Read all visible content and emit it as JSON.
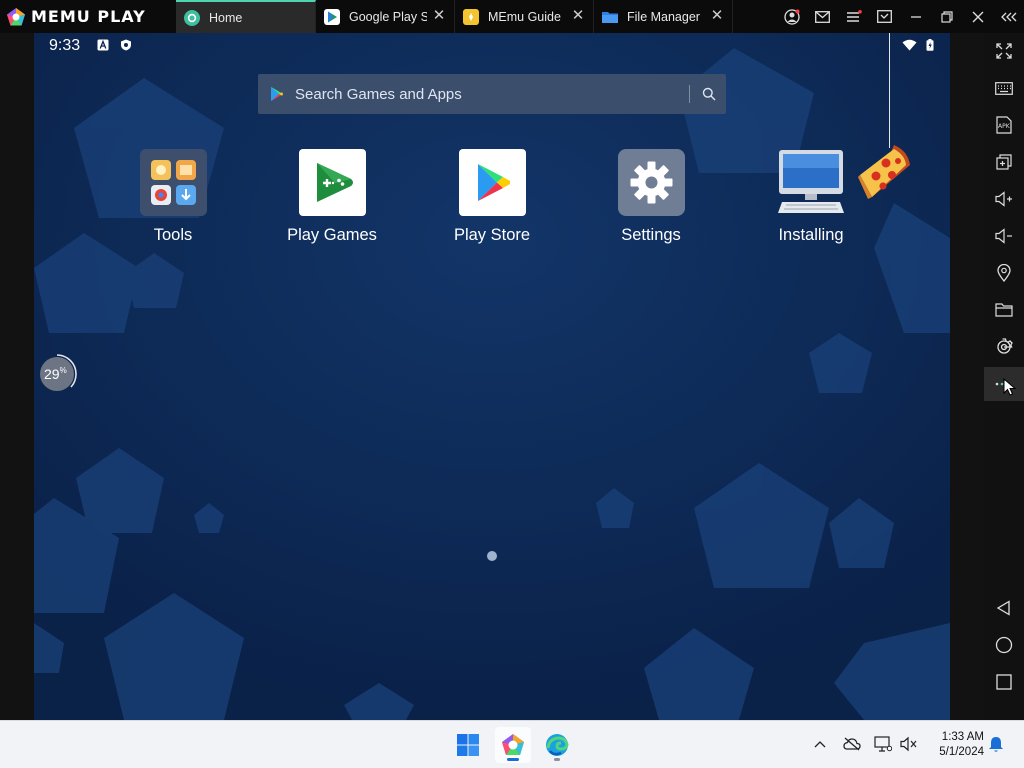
{
  "brand": {
    "name": "MEMU PLAY"
  },
  "tabs": [
    {
      "label": "Home",
      "icon": "memu-home-icon",
      "active": true
    },
    {
      "label": "Google Play S",
      "icon": "google-play-icon",
      "active": false
    },
    {
      "label": "MEmu Guide",
      "icon": "guide-icon",
      "active": false
    },
    {
      "label": "File Manager",
      "icon": "folder-icon",
      "active": false
    }
  ],
  "window_controls": [
    "account-icon",
    "mail-icon",
    "menu-icon",
    "multi-window-icon",
    "minimize-icon",
    "restore-icon",
    "close-icon",
    "collapse-sidebar-icon"
  ],
  "statusbar": {
    "time": "9:33"
  },
  "search": {
    "placeholder": "Search Games and Apps"
  },
  "apps": [
    {
      "label": "Tools",
      "icon": "tools-folder-icon"
    },
    {
      "label": "Play Games",
      "icon": "play-games-icon"
    },
    {
      "label": "Play Store",
      "icon": "play-store-icon"
    },
    {
      "label": "Settings",
      "icon": "settings-gear-icon"
    },
    {
      "label": "Installing",
      "icon": "computer-install-icon"
    }
  ],
  "progress": {
    "value": "29",
    "unit": "%"
  },
  "sidebar": [
    "fullscreen-icon",
    "keyboard-icon",
    "apk-icon",
    "add-window-icon",
    "volume-up-icon",
    "volume-down-icon",
    "location-icon",
    "folder-icon",
    "settings-icon",
    "more-icon",
    "back-icon",
    "home-icon",
    "recents-icon"
  ],
  "taskbar": {
    "time": "1:33 AM",
    "date": "5/1/2024"
  },
  "colors": {
    "screen_bg": "#0c2650",
    "accent": "#4fd3b0",
    "taskbar_bg": "#f1f3f7"
  }
}
